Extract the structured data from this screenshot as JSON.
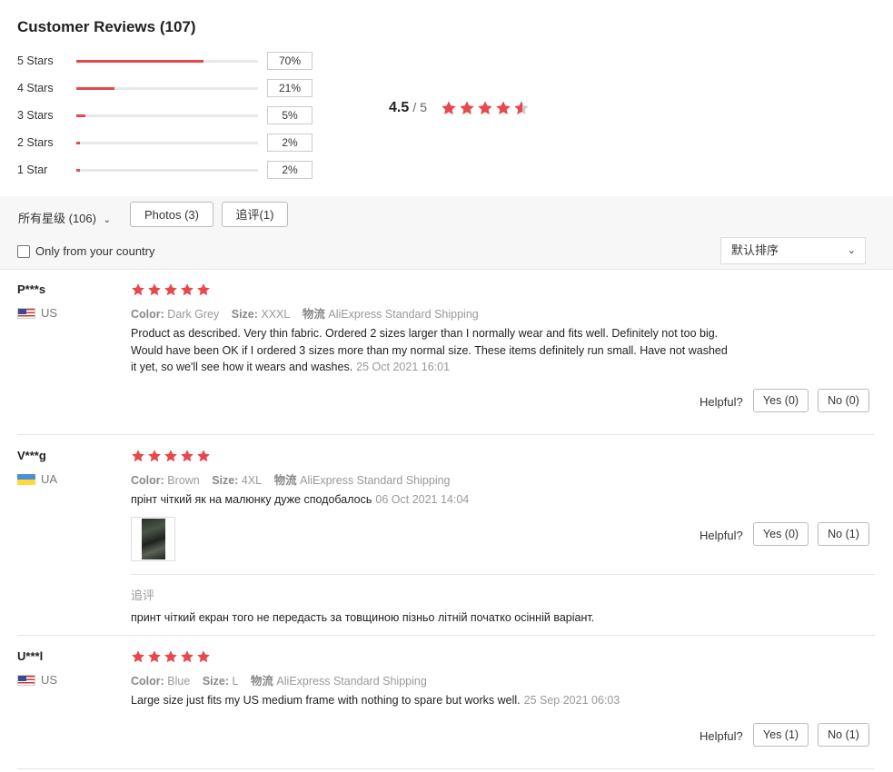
{
  "header": {
    "title": "Customer Reviews (107)"
  },
  "distribution": [
    {
      "label": "5 Stars",
      "pct": "70%",
      "fill": 0.7
    },
    {
      "label": "4 Stars",
      "pct": "21%",
      "fill": 0.21
    },
    {
      "label": "3 Stars",
      "pct": "5%",
      "fill": 0.05
    },
    {
      "label": "2 Stars",
      "pct": "2%",
      "fill": 0.02
    },
    {
      "label": "1 Star",
      "pct": "2%",
      "fill": 0.02
    }
  ],
  "rating": {
    "value": "4.5",
    "out_of": "/ 5",
    "stars": 4.5
  },
  "filters": {
    "all": "所有星级 (106)",
    "photos": "Photos (3)",
    "additional": "追评(1)",
    "country": "Only from your country",
    "sort": "默认排序"
  },
  "labels": {
    "color": "Color:",
    "size": "Size:",
    "shipping": "物流",
    "helpful": "Helpful?",
    "additional": "追评"
  },
  "reviews": [
    {
      "user": "P***s",
      "country": "US",
      "rating": 5,
      "color": "Dark Grey",
      "size": "XXXL",
      "shipping": "AliExpress Standard Shipping",
      "text_lines": [
        "Product as described. Very thin fabric. Ordered 2 sizes larger than I normally wear and fits well. Definitely not too big.",
        "Would have been OK if I ordered 3 sizes more than my normal size. These items definitely run small. Have not washed",
        "it yet, so we'll see how it wears and washes."
      ],
      "date": "25 Oct 2021 16:01",
      "yes": "Yes (0)",
      "no": "No (0)"
    },
    {
      "user": "V***g",
      "country": "UA",
      "rating": 5,
      "color": "Brown",
      "size": "4XL",
      "shipping": "AliExpress Standard Shipping",
      "text": "прінт чіткий як на малюнку дуже сподобалось",
      "date": "06 Oct 2021 14:04",
      "additional_text": "принт чіткий екран того не передасть за товщиною пізньо літній початко осінній варіант.",
      "yes": "Yes (0)",
      "no": "No (1)"
    },
    {
      "user": "U***l",
      "country": "US",
      "rating": 5,
      "color": "Blue",
      "size": "L",
      "shipping": "AliExpress Standard Shipping",
      "text": "Large size just fits my US medium frame with nothing to spare but works well.",
      "date": "25 Sep 2021 06:03",
      "yes": "Yes (1)",
      "no": "No (1)"
    }
  ],
  "colors": {
    "accent": "#e8484d",
    "star": "#e8484d",
    "star_empty": "#cccccc"
  }
}
